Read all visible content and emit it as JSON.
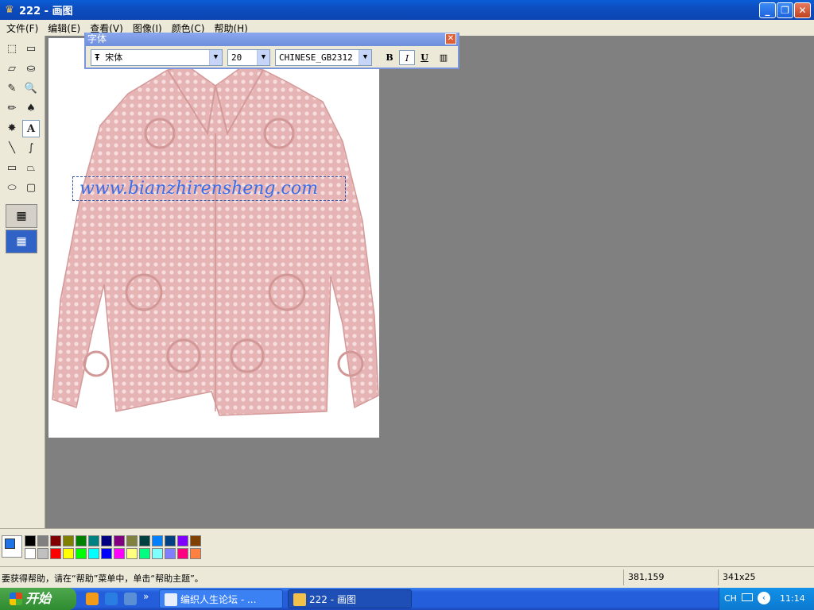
{
  "window": {
    "title": "222 - 画图",
    "app_icon": "paint-icon"
  },
  "title_buttons": {
    "minimize": "_",
    "restore": "❐",
    "close": "✕"
  },
  "menu": [
    "文件(F)",
    "编辑(E)",
    "查看(V)",
    "图像(I)",
    "颜色(C)",
    "帮助(H)"
  ],
  "toolbox": {
    "tools": [
      {
        "name": "free-select-icon",
        "glyph": "⬚"
      },
      {
        "name": "rect-select-icon",
        "glyph": "▭"
      },
      {
        "name": "eraser-icon",
        "glyph": "▱"
      },
      {
        "name": "fill-bucket-icon",
        "glyph": "⛀"
      },
      {
        "name": "color-picker-icon",
        "glyph": "✎"
      },
      {
        "name": "magnifier-icon",
        "glyph": "🔍"
      },
      {
        "name": "pencil-icon",
        "glyph": "✏"
      },
      {
        "name": "brush-icon",
        "glyph": "♠"
      },
      {
        "name": "airbrush-icon",
        "glyph": "✸"
      },
      {
        "name": "text-tool-icon",
        "glyph": "A"
      },
      {
        "name": "line-icon",
        "glyph": "╲"
      },
      {
        "name": "curve-icon",
        "glyph": "∫"
      },
      {
        "name": "rectangle-icon",
        "glyph": "▭"
      },
      {
        "name": "polygon-icon",
        "glyph": "⏢"
      },
      {
        "name": "ellipse-icon",
        "glyph": "⬭"
      },
      {
        "name": "rounded-rect-icon",
        "glyph": "▢"
      }
    ],
    "selected": "text-tool-icon"
  },
  "font_toolbar": {
    "title": "字体",
    "font_name": "宋体",
    "font_size": "20",
    "charset": "CHINESE_GB2312",
    "bold": "B",
    "italic": "I",
    "underline": "U",
    "vertical": "▥"
  },
  "canvas": {
    "text": "www.bianzhirensheng.com",
    "sweater_color": "#e0a8a8"
  },
  "palette": {
    "row1": [
      "#000000",
      "#808080",
      "#800000",
      "#808000",
      "#008000",
      "#008080",
      "#000080",
      "#800080",
      "#808040",
      "#004040",
      "#0080ff",
      "#004080",
      "#8000ff",
      "#804000"
    ],
    "row2": [
      "#ffffff",
      "#c0c0c0",
      "#ff0000",
      "#ffff00",
      "#00ff00",
      "#00ffff",
      "#0000ff",
      "#ff00ff",
      "#ffff80",
      "#00ff80",
      "#80ffff",
      "#8080ff",
      "#ff0080",
      "#ff8040"
    ]
  },
  "status": {
    "message": "要获得帮助，请在“帮助”菜单中，单击“帮助主题”。",
    "coords": "381,159",
    "size": "341x25"
  },
  "taskbar": {
    "start": "开始",
    "tasks": [
      "编织人生论坛 - ...",
      "222 - 画图"
    ],
    "lang": "CH",
    "time": "11:14"
  }
}
